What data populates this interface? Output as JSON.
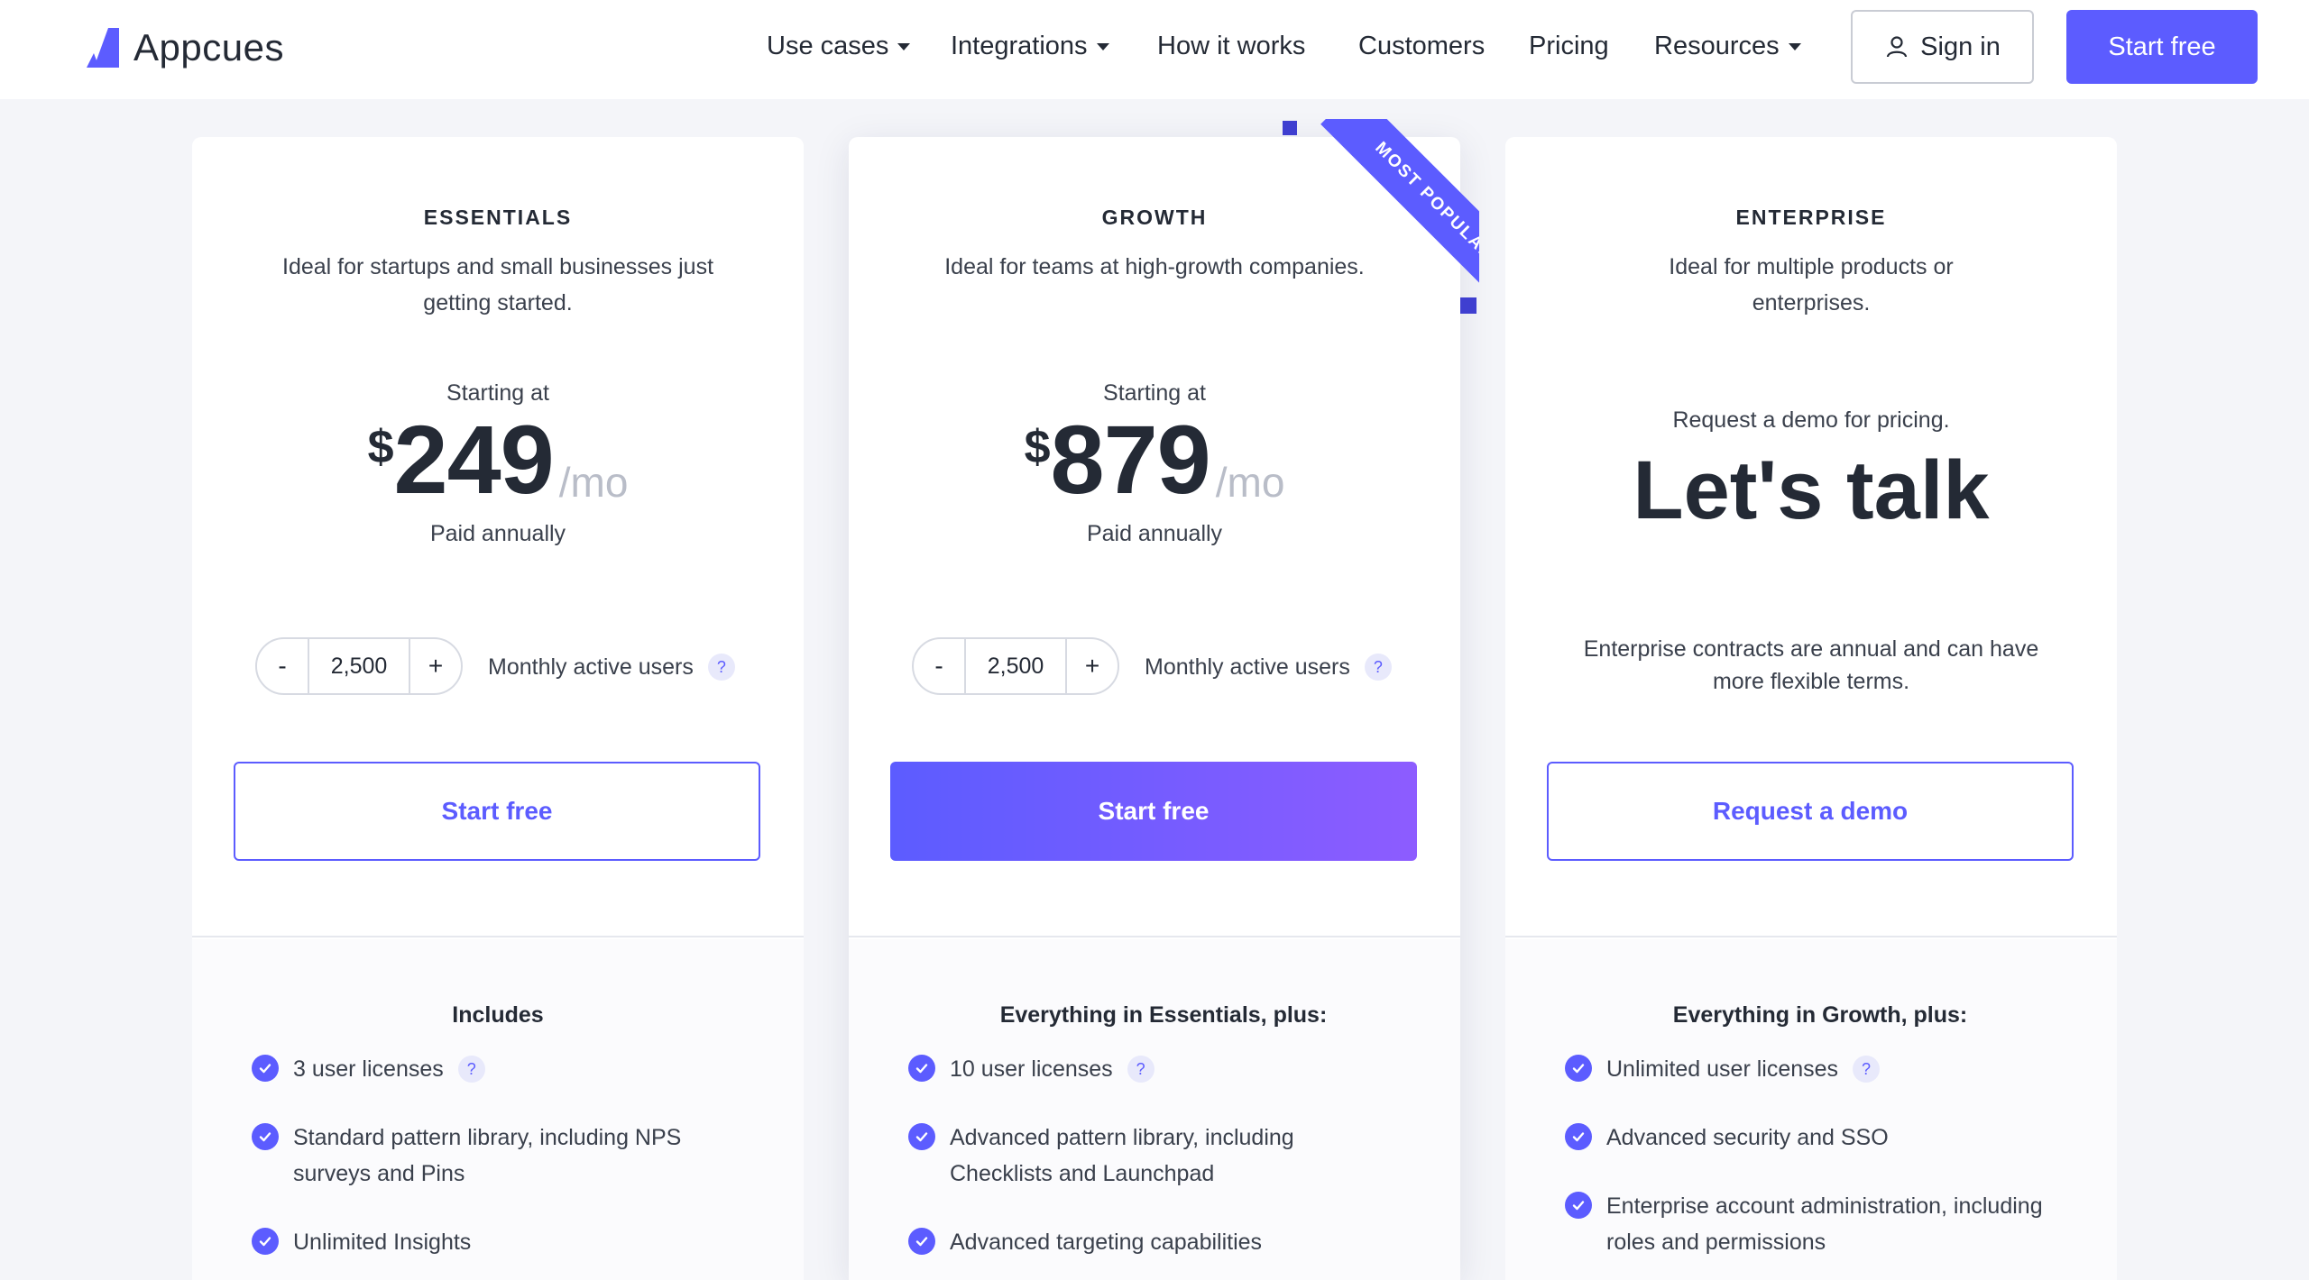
{
  "brand": {
    "name": "Appcues",
    "accent": "#5c5cff"
  },
  "nav": {
    "items": [
      {
        "label": "Use cases",
        "dropdown": true
      },
      {
        "label": "Integrations",
        "dropdown": true
      },
      {
        "label": "How it works",
        "dropdown": false
      },
      {
        "label": "Customers",
        "dropdown": false
      },
      {
        "label": "Pricing",
        "dropdown": false
      },
      {
        "label": "Resources",
        "dropdown": true
      }
    ],
    "sign_in": "Sign in",
    "start_free": "Start free"
  },
  "plans": [
    {
      "name": "ESSENTIALS",
      "desc": "Ideal for startups and small businesses just getting started.",
      "starting": "Starting at",
      "currency": "$",
      "price": "249",
      "per": "/mo",
      "billing": "Paid annually",
      "stepper": {
        "minus": "-",
        "value": "2,500",
        "plus": "+"
      },
      "mau_label": "Monthly active users",
      "help": "?",
      "cta": "Start free",
      "includes_heading": "Includes",
      "features": [
        {
          "text": "3 user licenses",
          "help": "?"
        },
        {
          "text": "Standard pattern library, including NPS surveys and Pins"
        },
        {
          "text": "Unlimited Insights"
        }
      ]
    },
    {
      "name": "GROWTH",
      "badge": "MOST POPULAR",
      "desc": "Ideal for teams at high-growth companies.",
      "starting": "Starting at",
      "currency": "$",
      "price": "879",
      "per": "/mo",
      "billing": "Paid annually",
      "stepper": {
        "minus": "-",
        "value": "2,500",
        "plus": "+"
      },
      "mau_label": "Monthly active users",
      "help": "?",
      "cta": "Start free",
      "includes_heading": "Everything in Essentials, plus:",
      "features": [
        {
          "text": "10 user licenses",
          "help": "?"
        },
        {
          "text": "Advanced pattern library, including Checklists and Launchpad"
        },
        {
          "text": "Advanced targeting capabilities"
        }
      ]
    },
    {
      "name": "ENTERPRISE",
      "desc": "Ideal for multiple products or enterprises.",
      "request": "Request a demo for pricing.",
      "headline": "Let's talk",
      "terms": "Enterprise contracts are annual and can have more flexible terms.",
      "cta": "Request a demo",
      "includes_heading": "Everything in Growth, plus:",
      "features": [
        {
          "text": "Unlimited user licenses",
          "help": "?"
        },
        {
          "text": "Advanced security and SSO"
        },
        {
          "text": "Enterprise account administration, including roles and permissions"
        }
      ]
    }
  ]
}
